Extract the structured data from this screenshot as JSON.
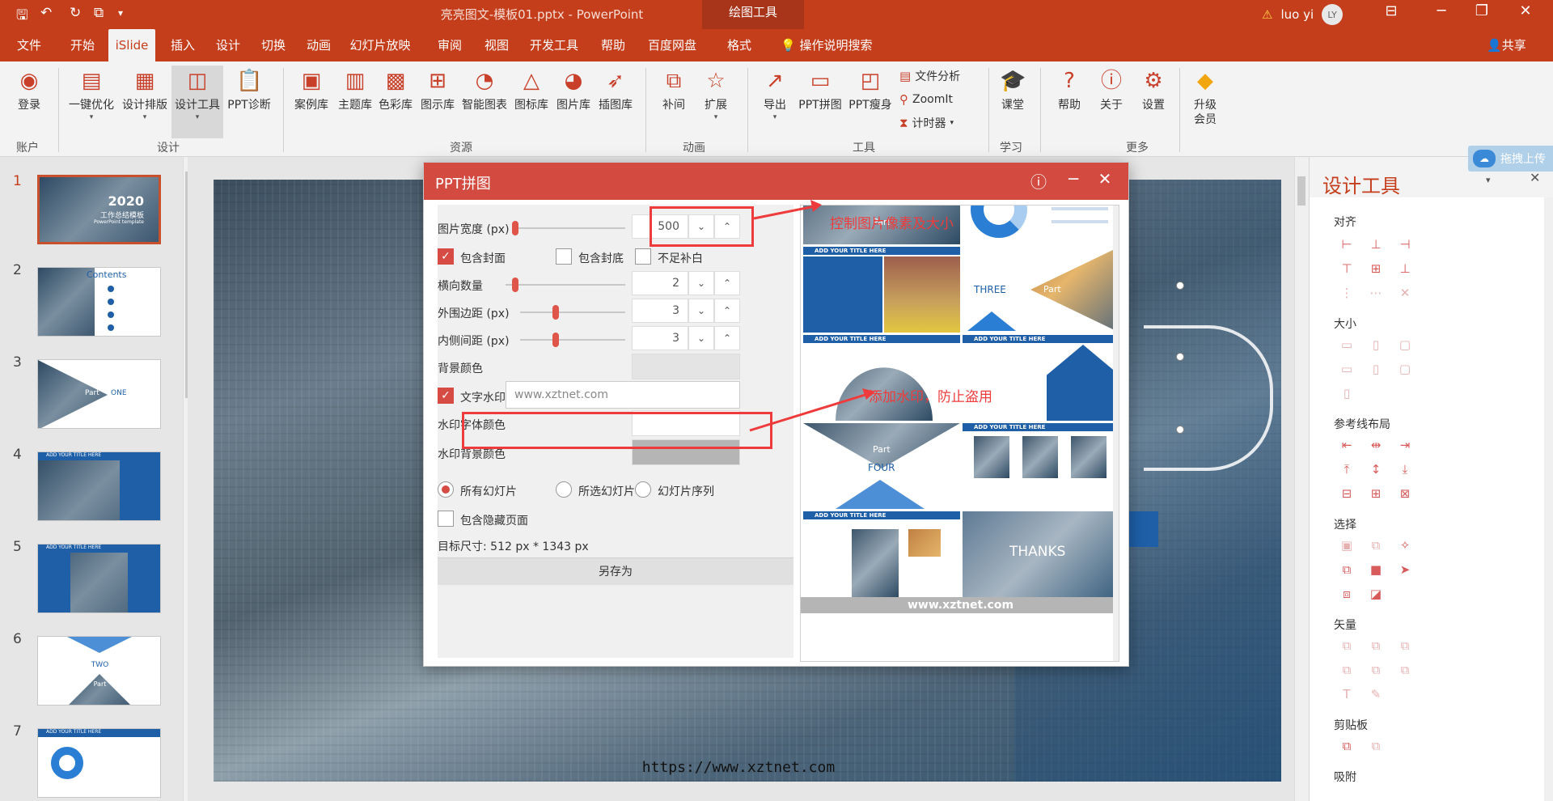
{
  "window": {
    "doc_title": "亮亮图文-模板01.pptx  -  PowerPoint",
    "context_tab": "绘图工具",
    "user_name": "luo yi",
    "avatar_initials": "LY"
  },
  "tabs": [
    "文件",
    "开始",
    "iSlide",
    "插入",
    "设计",
    "切换",
    "动画",
    "幻灯片放映",
    "审阅",
    "视图",
    "开发工具",
    "帮助",
    "百度网盘",
    "格式"
  ],
  "active_tab": "iSlide",
  "tell_me": "操作说明搜索",
  "share": "共享",
  "ribbon": {
    "buttons": [
      {
        "label": "登录",
        "icon": "user-circle-icon"
      },
      {
        "label": "一键优化",
        "icon": "layers-icon"
      },
      {
        "label": "设计排版",
        "icon": "grid-icon"
      },
      {
        "label": "设计工具",
        "icon": "layout-icon"
      },
      {
        "label": "PPT诊断",
        "icon": "clipboard-icon"
      },
      {
        "label": "案例库",
        "icon": "case-icon"
      },
      {
        "label": "主题库",
        "icon": "theme-icon"
      },
      {
        "label": "色彩库",
        "icon": "palette-icon"
      },
      {
        "label": "图示库",
        "icon": "diagram-icon"
      },
      {
        "label": "智能图表",
        "icon": "pie-chart-icon"
      },
      {
        "label": "图标库",
        "icon": "shapes-icon"
      },
      {
        "label": "图片库",
        "icon": "image-icon"
      },
      {
        "label": "插图库",
        "icon": "rocket-icon"
      },
      {
        "label": "补间",
        "icon": "tween-icon"
      },
      {
        "label": "扩展",
        "icon": "star-icon"
      },
      {
        "label": "导出",
        "icon": "export-icon"
      },
      {
        "label": "PPT拼图",
        "icon": "puzzle-icon"
      },
      {
        "label": "PPT瘦身",
        "icon": "compress-icon"
      },
      {
        "label": "课堂",
        "icon": "graduation-icon"
      },
      {
        "label": "帮助",
        "icon": "help-icon"
      },
      {
        "label": "关于",
        "icon": "info-icon"
      },
      {
        "label": "设置",
        "icon": "settings-icon"
      },
      {
        "label": "升级会员",
        "icon": "diamond-icon"
      }
    ],
    "small_buttons": [
      "文件分析",
      "ZoomIt",
      "计时器"
    ],
    "groups": [
      "账户",
      "设计",
      "资源",
      "动画",
      "工具",
      "学习",
      "更多"
    ]
  },
  "slides": [
    {
      "num": "1",
      "title": "2020",
      "subtitle": "工作总结模板",
      "sub2": "PowerPoint template"
    },
    {
      "num": "2",
      "title": "Contents"
    },
    {
      "num": "3",
      "title": "Part",
      "extra": "ONE"
    },
    {
      "num": "4",
      "title": "ADD YOUR TITLE HERE"
    },
    {
      "num": "5",
      "title": "ADD YOUR TITLE HERE"
    },
    {
      "num": "6",
      "title": "TWO",
      "extra": "Part"
    },
    {
      "num": "7",
      "title": "ADD YOUR TITLE HERE"
    }
  ],
  "caption": "https://www.xztnet.com",
  "right_pane": {
    "title": "设计工具",
    "upload": "拖拽上传",
    "sections": [
      "对齐",
      "大小",
      "参考线布局",
      "选择",
      "矢量",
      "剪贴板",
      "吸附"
    ]
  },
  "dialog": {
    "title": "PPT拼图",
    "image_width_label": "图片宽度 (px)",
    "image_width": "500",
    "include_cover": "包含封面",
    "include_back": "包含封底",
    "pad_blank": "不足补白",
    "h_count_label": "横向数量",
    "h_count": "2",
    "outer_margin_label": "外围边距 (px)",
    "outer_margin": "3",
    "inner_spacing_label": "内侧间距 (px)",
    "inner_spacing": "3",
    "bg_color_label": "背景颜色",
    "watermark_label": "文字水印",
    "watermark_value": "www.xztnet.com",
    "wm_font_color_label": "水印字体颜色",
    "wm_bg_color_label": "水印背景颜色",
    "all_slides": "所有幻灯片",
    "selected_slides": "所选幻灯片",
    "slide_sequence": "幻灯片序列",
    "include_hidden": "包含隐藏页面",
    "target_size": "目标尺寸:   512 px *  1343 px",
    "save_as": "另存为",
    "preview_watermark": "www.xztnet.com",
    "preview": {
      "p1": "Part",
      "p3": "ADD YOUR TITLE HERE",
      "p4a": "THREE",
      "p4b": "Part",
      "p5": "ADD YOUR TITLE HERE",
      "p6": "ADD YOUR TITLE HERE",
      "p7a": "Part",
      "p7b": "FOUR",
      "p8": "ADD YOUR TITLE HERE",
      "p9": "ADD YOUR TITLE HERE",
      "p10": "THANKS"
    }
  },
  "annotations": {
    "size": "控制图片像素及大小",
    "watermark": "添加水印，防止盗用"
  },
  "colors": {
    "accent": "#c43e1c",
    "dialog_header": "#d24a40",
    "annotation": "#ee3b3b",
    "brand_blue": "#1e5fa8"
  }
}
